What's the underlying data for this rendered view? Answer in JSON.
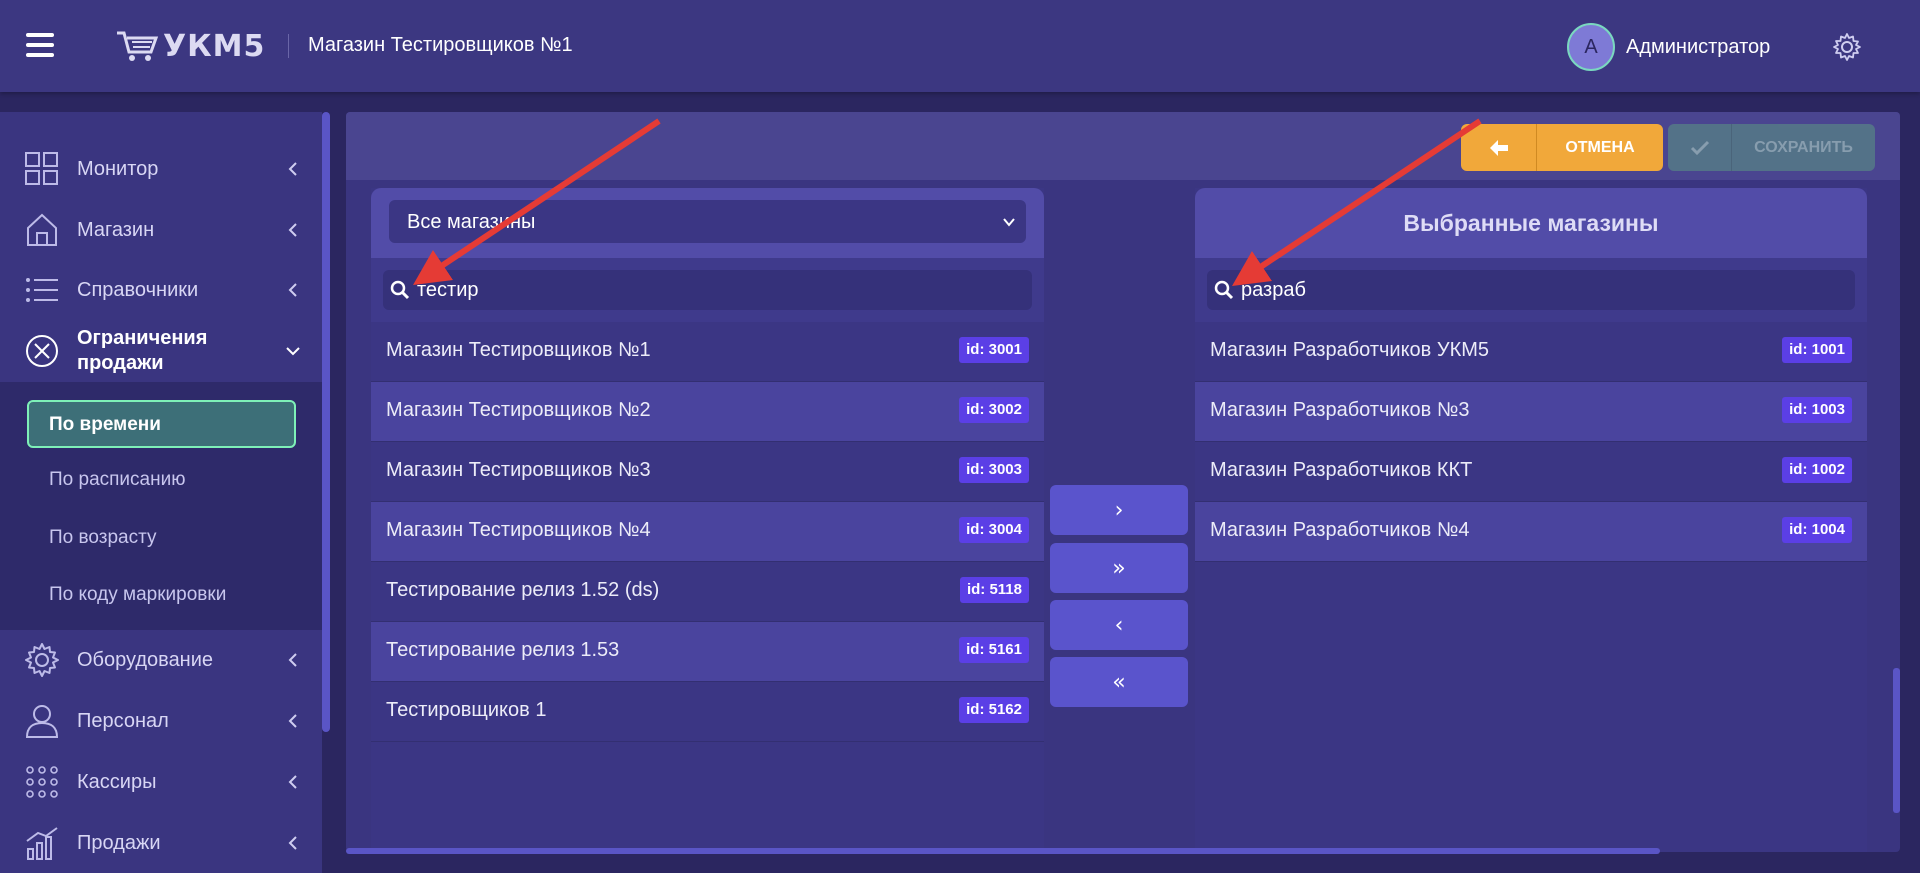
{
  "header": {
    "logo_text": "УКМ5",
    "store_title": "Магазин Тестировщиков №1",
    "avatar_letter": "A",
    "user_name": "Администратор"
  },
  "sidebar": {
    "items": [
      {
        "label": "Монитор",
        "icon": "dashboard-icon"
      },
      {
        "label": "Магазин",
        "icon": "store-icon"
      },
      {
        "label": "Справочники",
        "icon": "list-icon"
      },
      {
        "label": "Ограничения продажи",
        "icon": "circle-x-icon"
      },
      {
        "label": "Оборудование",
        "icon": "gear-icon"
      },
      {
        "label": "Персонал",
        "icon": "person-icon"
      },
      {
        "label": "Кассиры",
        "icon": "grid-dots-icon"
      },
      {
        "label": "Продажи",
        "icon": "chart-icon"
      }
    ],
    "subitems": [
      {
        "label": "По времени"
      },
      {
        "label": "По расписанию"
      },
      {
        "label": "По возрасту"
      },
      {
        "label": "По коду маркировки"
      }
    ]
  },
  "toolbar": {
    "cancel_label": "ОТМЕНА",
    "save_label": "СОХРАНИТЬ"
  },
  "left_panel": {
    "select_value": "Все магазины",
    "search_value": "тестир",
    "rows": [
      {
        "name": "Магазин Тестировщиков №1",
        "id": "id: 3001"
      },
      {
        "name": "Магазин Тестировщиков №2",
        "id": "id: 3002"
      },
      {
        "name": "Магазин Тестировщиков №3",
        "id": "id: 3003"
      },
      {
        "name": "Магазин Тестировщиков №4",
        "id": "id: 3004"
      },
      {
        "name": "Тестирование релиз 1.52 (ds)",
        "id": "id: 5118"
      },
      {
        "name": "Тестирование релиз 1.53",
        "id": "id: 5161"
      },
      {
        "name": "Тестировщиков 1",
        "id": "id: 5162"
      }
    ]
  },
  "right_panel": {
    "title": "Выбранные магазины",
    "search_value": "разраб",
    "rows": [
      {
        "name": "Магазин Разработчиков УКМ5",
        "id": "id: 1001"
      },
      {
        "name": "Магазин Разработчиков №3",
        "id": "id: 1003"
      },
      {
        "name": "Магазин Разработчиков ККТ",
        "id": "id: 1002"
      },
      {
        "name": "Магазин Разработчиков №4",
        "id": "id: 1004"
      }
    ]
  },
  "move_buttons": [
    {
      "glyph": "›",
      "action": "move-one-right"
    },
    {
      "glyph": "»",
      "action": "move-all-right"
    },
    {
      "glyph": "‹",
      "action": "move-one-left"
    },
    {
      "glyph": "«",
      "action": "move-all-left"
    }
  ],
  "colors": {
    "background": "#2b2660",
    "panel": "#3b3684",
    "accent_orange": "#f1a83a",
    "id_badge": "#5b3fe6",
    "active_border": "#7ef0b8",
    "annotation_arrow": "#e53b35"
  }
}
